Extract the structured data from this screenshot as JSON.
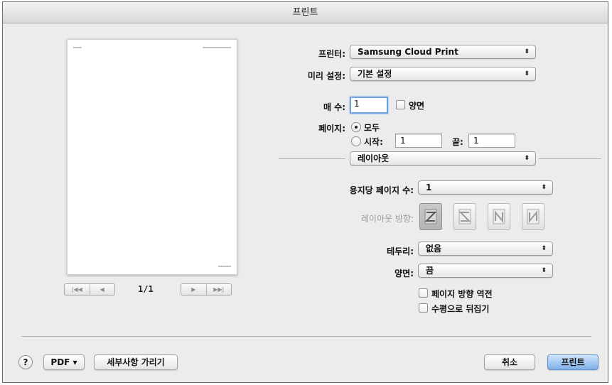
{
  "window": {
    "title": "프린트"
  },
  "preview": {
    "page_indicator": "1/1",
    "nav_left": [
      "|◀◀",
      "◀"
    ],
    "nav_right": [
      "▶",
      "▶▶|"
    ]
  },
  "printer": {
    "label": "프린터:",
    "value": "Samsung Cloud Print"
  },
  "presets": {
    "label": "미리 설정:",
    "value": "기본 설정"
  },
  "copies": {
    "label": "매 수:",
    "value": "1",
    "duplex_label": "양면",
    "duplex_checked": false
  },
  "pages": {
    "label": "페이지:",
    "all_label": "모두",
    "all_selected": true,
    "from_label": "시작:",
    "from_value": "1",
    "to_label": "끝:",
    "to_value": "1"
  },
  "section_popup": {
    "value": "레이아웃"
  },
  "layout": {
    "pages_per_sheet_label": "용지당 페이지 수:",
    "pages_per_sheet_value": "1",
    "direction_label": "레이아웃 방향:",
    "border_label": "테두리:",
    "border_value": "없음",
    "two_sided_label": "양면:",
    "two_sided_value": "끔",
    "reverse_orientation_label": "페이지 방향 역전",
    "reverse_orientation_checked": false,
    "flip_horizontal_label": "수평으로 뒤집기",
    "flip_horizontal_checked": false
  },
  "bottom": {
    "help_label": "?",
    "pdf_label": "PDF ▾",
    "hide_details_label": "세부사항 가리기",
    "cancel_label": "취소",
    "print_label": "프린트"
  },
  "icons": {
    "popup_arrows": "⬍",
    "selected_direction": "layout-direction-z-icon"
  }
}
